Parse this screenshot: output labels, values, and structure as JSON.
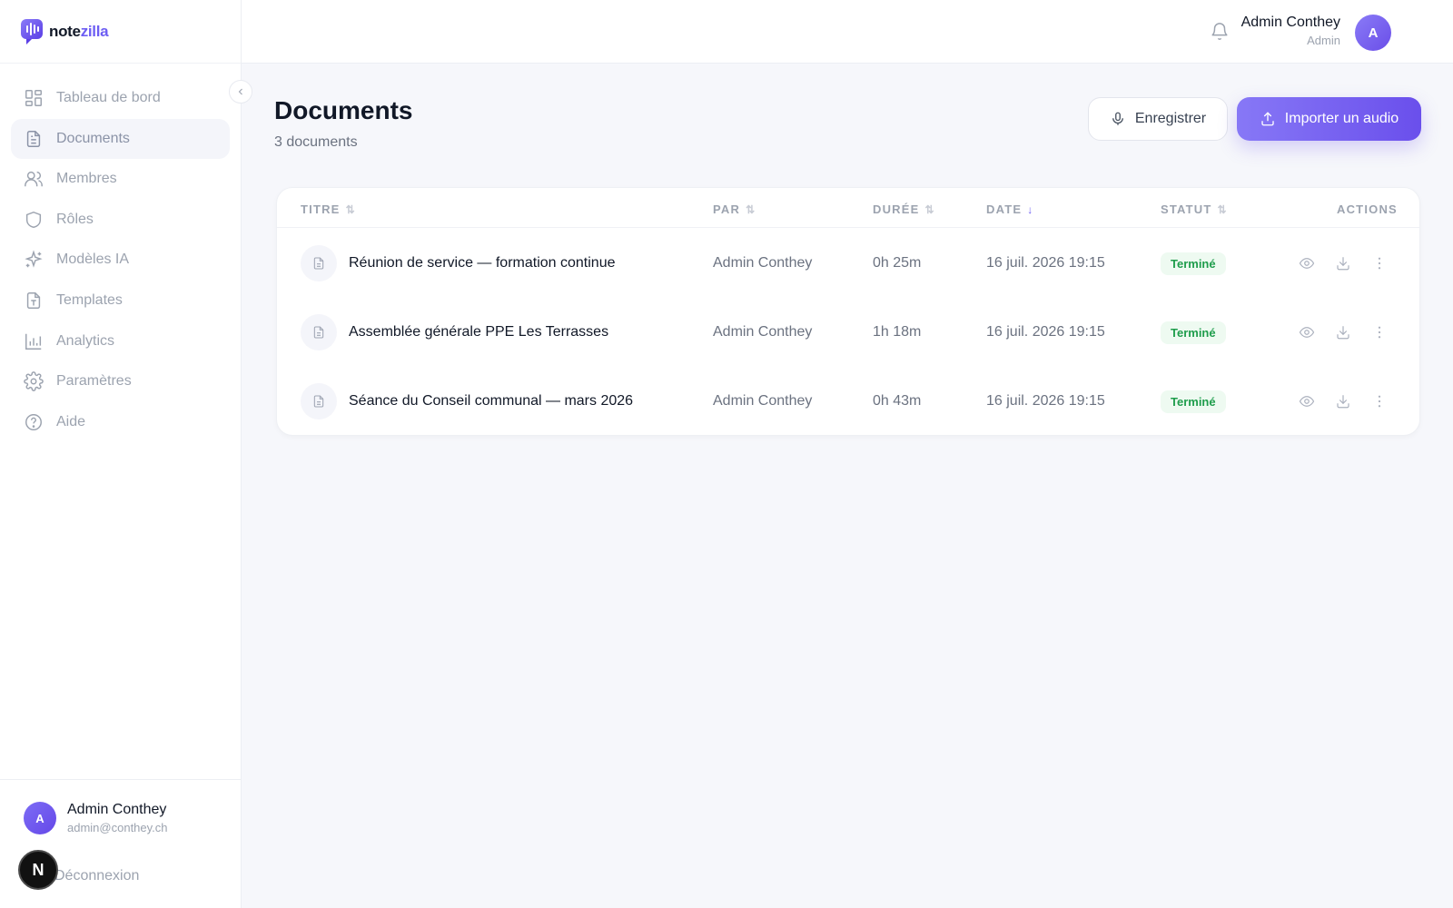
{
  "app": {
    "logo_part1": "note",
    "logo_part2": "zilla",
    "accent": "#6d5ef3",
    "logo_icon": "microphone-wave-icon"
  },
  "sidebar": {
    "items": [
      {
        "label": "Tableau de bord",
        "icon": "dashboard-grid-icon",
        "active": false
      },
      {
        "label": "Documents",
        "icon": "document-icon",
        "active": true
      },
      {
        "label": "Membres",
        "icon": "users-icon",
        "active": false
      },
      {
        "label": "Rôles",
        "icon": "shield-icon",
        "active": false
      },
      {
        "label": "Modèles IA",
        "icon": "sparkles-icon",
        "active": false
      },
      {
        "label": "Templates",
        "icon": "file-template-icon",
        "active": false
      },
      {
        "label": "Analytics",
        "icon": "bar-chart-icon",
        "active": false
      },
      {
        "label": "Paramètres",
        "icon": "gear-icon",
        "active": false
      },
      {
        "label": "Aide",
        "icon": "help-circle-icon",
        "active": false
      }
    ],
    "footer": {
      "avatar_initial": "A",
      "name": "Admin Conthey",
      "email": "admin@conthey.ch",
      "logout_label": "Déconnexion",
      "badge_letter": "N"
    }
  },
  "topbar": {
    "user_name": "Admin Conthey",
    "user_role": "Admin",
    "avatar_initial": "A"
  },
  "page": {
    "title": "Documents",
    "subtitle": "3 documents",
    "record_label": "Enregistrer",
    "import_label": "Importer un audio"
  },
  "table": {
    "columns": {
      "title": "TITRE",
      "by": "PAR",
      "duration": "DURÉE",
      "date": "DATE",
      "status": "STATUT",
      "actions": "ACTIONS"
    },
    "rows": [
      {
        "title": "Réunion de service — formation continue",
        "by": "Admin Conthey",
        "duration": "0h 25m",
        "date": "16 juil. 2026 19:15",
        "status": "Terminé"
      },
      {
        "title": "Assemblée générale PPE Les Terrasses",
        "by": "Admin Conthey",
        "duration": "1h 18m",
        "date": "16 juil. 2026 19:15",
        "status": "Terminé"
      },
      {
        "title": "Séance du Conseil communal — mars 2026",
        "by": "Admin Conthey",
        "duration": "0h 43m",
        "date": "16 juil. 2026 19:15",
        "status": "Terminé"
      }
    ],
    "status_color": "#1f9d4c"
  }
}
